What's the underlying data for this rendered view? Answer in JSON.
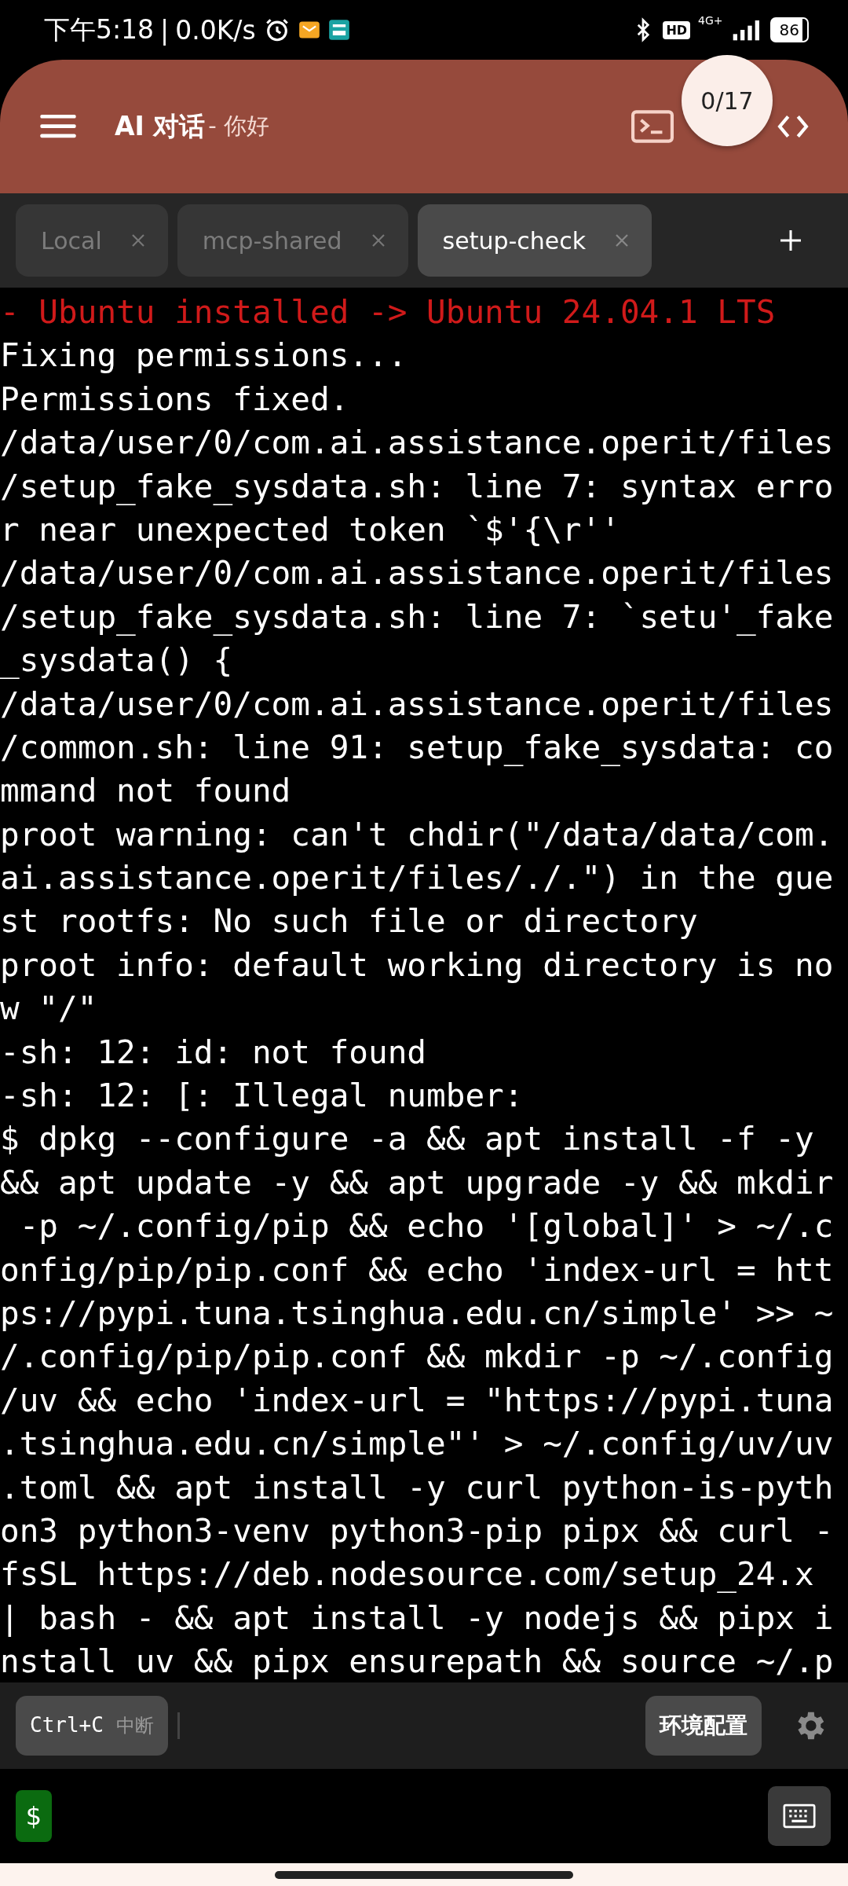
{
  "status_bar": {
    "time": "下午5:18",
    "separator": "|",
    "speed": "0.0K/s",
    "network": "4G+",
    "hd": "HD",
    "battery": "86"
  },
  "header": {
    "title": "AI 对话",
    "subtitle": "- 你好",
    "badge": "0/17"
  },
  "tabs": [
    {
      "label": "Local",
      "selected": false
    },
    {
      "label": "mcp-shared",
      "selected": false
    },
    {
      "label": "setup-check",
      "selected": true
    }
  ],
  "terminal": {
    "lines": [
      {
        "kind": "error",
        "text": "- Ubuntu installed -> Ubuntu 24.04.1 LTS"
      },
      {
        "kind": "output",
        "text": "Fixing permissions..."
      },
      {
        "kind": "output",
        "text": "Permissions fixed."
      },
      {
        "kind": "output",
        "text": "/data/user/0/com.ai.assistance.operit/files"
      },
      {
        "kind": "output",
        "text": "/setup_fake_sysdata.sh: line 7: syntax erro"
      },
      {
        "kind": "output",
        "text": "r near unexpected token `$'{\\r''"
      },
      {
        "kind": "output",
        "text": "/data/user/0/com.ai.assistance.operit/files"
      },
      {
        "kind": "output",
        "text": "/setup_fake_sysdata.sh: line 7: `setu'_fake"
      },
      {
        "kind": "output",
        "text": "_sysdata() {"
      },
      {
        "kind": "output",
        "text": "/data/user/0/com.ai.assistance.operit/files"
      },
      {
        "kind": "output",
        "text": "/common.sh: line 91: setup_fake_sysdata: co"
      },
      {
        "kind": "output",
        "text": "mmand not found"
      },
      {
        "kind": "output",
        "text": "proot warning: can't chdir(\"/data/data/com."
      },
      {
        "kind": "output",
        "text": "ai.assistance.operit/files/./.\") in the gue"
      },
      {
        "kind": "output",
        "text": "st rootfs: No such file or directory"
      },
      {
        "kind": "output",
        "text": "proot info: default working directory is no"
      },
      {
        "kind": "output",
        "text": "w \"/\""
      },
      {
        "kind": "output",
        "text": "-sh: 12: id: not found"
      },
      {
        "kind": "output",
        "text": "-sh: 12: [: Illegal number:"
      },
      {
        "kind": "output",
        "text": "$ dpkg --configure -a && apt install -f -y"
      },
      {
        "kind": "output",
        "text": "&& apt update -y && apt upgrade -y && mkdir"
      },
      {
        "kind": "output",
        "text": " -p ~/.config/pip && echo '[global]' > ~/.c"
      },
      {
        "kind": "output",
        "text": "onfig/pip/pip.conf && echo 'index-url = htt"
      },
      {
        "kind": "output",
        "text": "ps://pypi.tuna.tsinghua.edu.cn/simple' >> ~"
      },
      {
        "kind": "output",
        "text": "/.config/pip/pip.conf && mkdir -p ~/.config"
      },
      {
        "kind": "output",
        "text": "/uv && echo 'index-url = \"https://pypi.tuna"
      },
      {
        "kind": "output",
        "text": ".tsinghua.edu.cn/simple\"' > ~/.config/uv/uv"
      },
      {
        "kind": "output",
        "text": ".toml && apt install -y curl python-is-pyth"
      },
      {
        "kind": "output",
        "text": "on3 python3-venv python3-pip pipx && curl -"
      },
      {
        "kind": "output",
        "text": "fsSL https://deb.nodesource.com/setup_24.x"
      },
      {
        "kind": "output",
        "text": "| bash - && apt install -y nodejs && pipx i"
      },
      {
        "kind": "output",
        "text": "nstall uv && pipx ensurepath && source ~/.p"
      }
    ]
  },
  "toolbar": {
    "interrupt_key": "Ctrl+C",
    "interrupt_label": "中断",
    "env_button": "环境配置"
  },
  "input": {
    "prompt": "$"
  }
}
